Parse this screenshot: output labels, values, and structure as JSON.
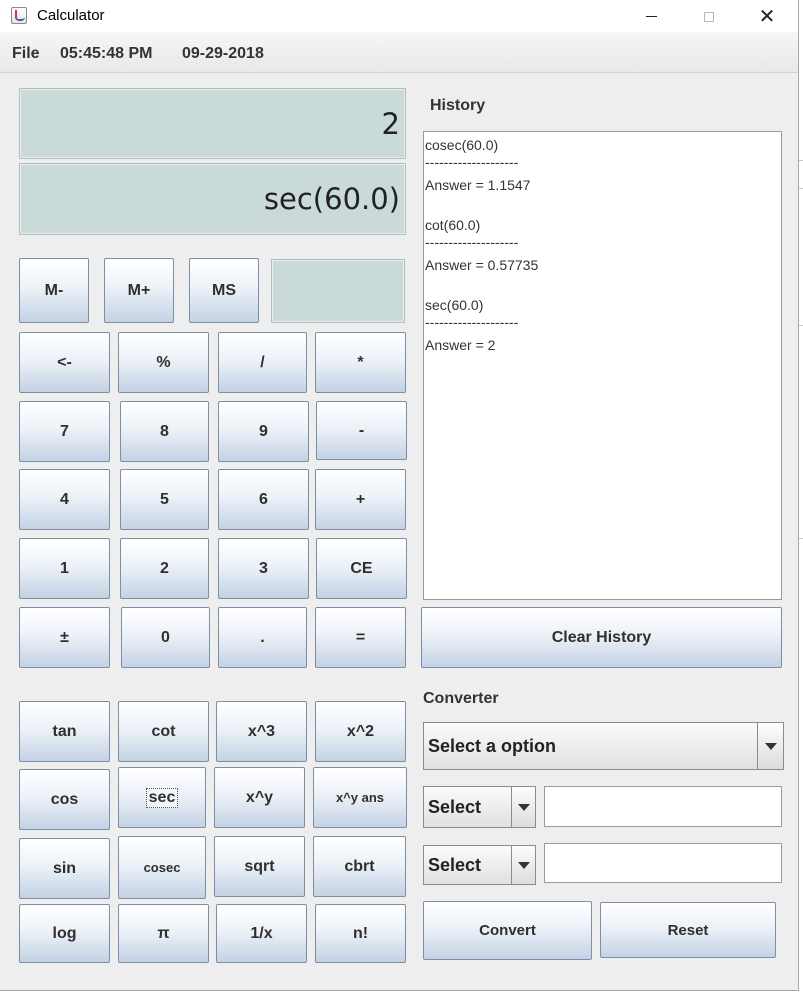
{
  "window": {
    "title": "Calculator",
    "caption": {
      "close_glyph": "✕"
    }
  },
  "menubar": {
    "file": "File",
    "time": "05:45:48 PM",
    "date": "09-29-2018"
  },
  "display": {
    "result": "2",
    "expression": "sec(60.0)",
    "memory": ""
  },
  "memory_buttons": [
    "M-",
    "M+",
    "MS"
  ],
  "keypad": [
    [
      "<-",
      "%",
      "/",
      "*"
    ],
    [
      "7",
      "8",
      "9",
      "-"
    ],
    [
      "4",
      "5",
      "6",
      "+"
    ],
    [
      "1",
      "2",
      "3",
      "CE"
    ],
    [
      "±",
      "0",
      ".",
      "="
    ]
  ],
  "scientific": [
    [
      "tan",
      "cot",
      "x^3",
      "x^2"
    ],
    [
      "cos",
      "sec",
      "x^y",
      "x^y ans"
    ],
    [
      "sin",
      "cosec",
      "sqrt",
      "cbrt"
    ],
    [
      "log",
      "π",
      "1/x",
      "n!"
    ]
  ],
  "history": {
    "label": "History",
    "lines": [
      "cosec(60.0)",
      "--------------------",
      "Answer = 1.1547",
      "",
      "cot(60.0)",
      "--------------------",
      "Answer = 0.57735",
      "",
      "sec(60.0)",
      "--------------------",
      "Answer = 2"
    ],
    "clear_label": "Clear History"
  },
  "converter": {
    "label": "Converter",
    "type_selected": "Select a option",
    "from_unit": "Select",
    "to_unit": "Select",
    "from_value": "",
    "to_value": "",
    "convert_label": "Convert",
    "reset_label": "Reset"
  },
  "colors": {
    "display_bg": "#c9dad9",
    "button_top": "#ffffff",
    "button_bottom": "#c3d2e4",
    "window_bg": "#eeeeee"
  },
  "icons": [
    "java-app-icon",
    "minimize-icon",
    "maximize-icon",
    "close-icon",
    "dropdown-arrow-icon"
  ]
}
